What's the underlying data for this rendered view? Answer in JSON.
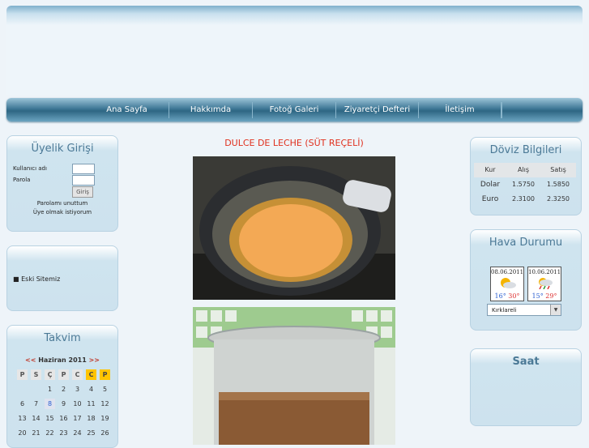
{
  "nav": {
    "items": [
      "Ana Sayfa",
      "Hakkımda",
      "Fotoğ Galeri",
      "Ziyaretçi Defteri",
      "İletişim"
    ]
  },
  "login": {
    "title": "Üyelik Girişi",
    "username_label": "Kullanıcı adı",
    "password_label": "Parola",
    "submit_label": "Giriş",
    "forgot_link": "Parolamı unuttum",
    "register_link": "Üye olmak istiyorum"
  },
  "links_box": {
    "item": "■ Eski Sitemiz"
  },
  "calendar": {
    "title": "Takvim",
    "month_label": "Haziran 2011",
    "prev": "<<",
    "next": ">>",
    "weekdays": [
      "P",
      "S",
      "Ç",
      "P",
      "C",
      "C",
      "P"
    ],
    "rows": [
      [
        "",
        "",
        "1",
        "2",
        "3",
        "4",
        "5"
      ],
      [
        "6",
        "7",
        "8",
        "9",
        "10",
        "11",
        "12"
      ],
      [
        "13",
        "14",
        "15",
        "16",
        "17",
        "18",
        "19"
      ],
      [
        "20",
        "21",
        "22",
        "23",
        "24",
        "25",
        "26"
      ]
    ],
    "today": "8"
  },
  "article": {
    "title": "DULCE DE LECHE (SÜT REÇELİ)"
  },
  "currency": {
    "title": "Döviz Bilgileri",
    "headers": [
      "Kur",
      "Alış",
      "Satış"
    ],
    "rows": [
      [
        "Dolar",
        "1.5750",
        "1.5850"
      ],
      [
        "Euro",
        "2.3100",
        "2.3250"
      ]
    ]
  },
  "weather": {
    "title": "Hava Durumu",
    "days": [
      {
        "date": "08.06.2011",
        "low": "16°",
        "high": "30°"
      },
      {
        "date": "10.06.2011",
        "low": "15°",
        "high": "29°"
      }
    ],
    "city": "Kırklareli"
  },
  "clock": {
    "title": "Saat"
  },
  "colors": {
    "accent": "#4b7996",
    "title_red": "#e0301e",
    "calendar_weekend": "#ffc400"
  }
}
